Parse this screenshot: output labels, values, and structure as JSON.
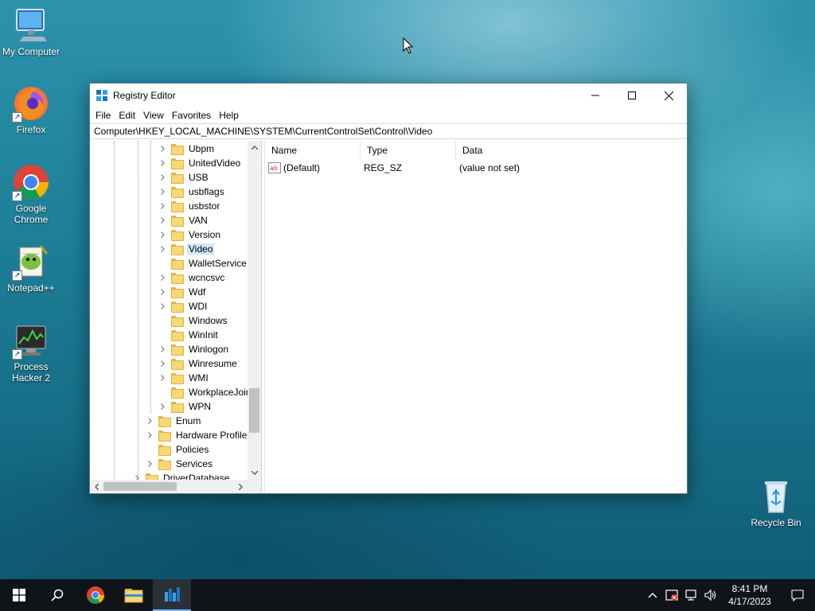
{
  "desktop": {
    "icons": [
      {
        "name": "my-computer",
        "label": "My Computer"
      },
      {
        "name": "firefox",
        "label": "Firefox"
      },
      {
        "name": "google-chrome",
        "label": "Google Chrome"
      },
      {
        "name": "notepad-plus-plus",
        "label": "Notepad++"
      },
      {
        "name": "process-hacker",
        "label": "Process Hacker 2"
      },
      {
        "name": "recycle-bin",
        "label": "Recycle Bin"
      }
    ]
  },
  "window": {
    "title": "Registry Editor",
    "menu": [
      "File",
      "Edit",
      "View",
      "Favorites",
      "Help"
    ],
    "address": "Computer\\HKEY_LOCAL_MACHINE\\SYSTEM\\CurrentControlSet\\Control\\Video",
    "tree": [
      {
        "label": "Ubpm",
        "expandable": true,
        "level": 2
      },
      {
        "label": "UnitedVideo",
        "expandable": true,
        "level": 2
      },
      {
        "label": "USB",
        "expandable": true,
        "level": 2
      },
      {
        "label": "usbflags",
        "expandable": true,
        "level": 2
      },
      {
        "label": "usbstor",
        "expandable": true,
        "level": 2
      },
      {
        "label": "VAN",
        "expandable": true,
        "level": 2
      },
      {
        "label": "Version",
        "expandable": true,
        "level": 2
      },
      {
        "label": "Video",
        "expandable": true,
        "level": 2,
        "selected": true
      },
      {
        "label": "WalletService",
        "expandable": false,
        "level": 2
      },
      {
        "label": "wcncsvc",
        "expandable": true,
        "level": 2
      },
      {
        "label": "Wdf",
        "expandable": true,
        "level": 2
      },
      {
        "label": "WDI",
        "expandable": true,
        "level": 2
      },
      {
        "label": "Windows",
        "expandable": false,
        "level": 2
      },
      {
        "label": "WinInit",
        "expandable": false,
        "level": 2
      },
      {
        "label": "Winlogon",
        "expandable": true,
        "level": 2
      },
      {
        "label": "Winresume",
        "expandable": true,
        "level": 2
      },
      {
        "label": "WMI",
        "expandable": true,
        "level": 2
      },
      {
        "label": "WorkplaceJoin",
        "expandable": false,
        "level": 2
      },
      {
        "label": "WPN",
        "expandable": true,
        "level": 2
      },
      {
        "label": "Enum",
        "expandable": true,
        "level": 1
      },
      {
        "label": "Hardware Profiles",
        "expandable": true,
        "level": 1
      },
      {
        "label": "Policies",
        "expandable": false,
        "level": 1
      },
      {
        "label": "Services",
        "expandable": true,
        "level": 1
      },
      {
        "label": "DriverDatabase",
        "expandable": true,
        "level": 0
      }
    ],
    "columns": [
      "Name",
      "Type",
      "Data"
    ],
    "values": [
      {
        "name": "(Default)",
        "type": "REG_SZ",
        "data": "(value not set)"
      }
    ]
  },
  "taskbar": {
    "time": "8:41 PM",
    "date": "4/17/2023"
  },
  "colors": {
    "selection": "#cce8ff",
    "taskbar": "#101418",
    "active_indicator": "#76b9ed"
  }
}
